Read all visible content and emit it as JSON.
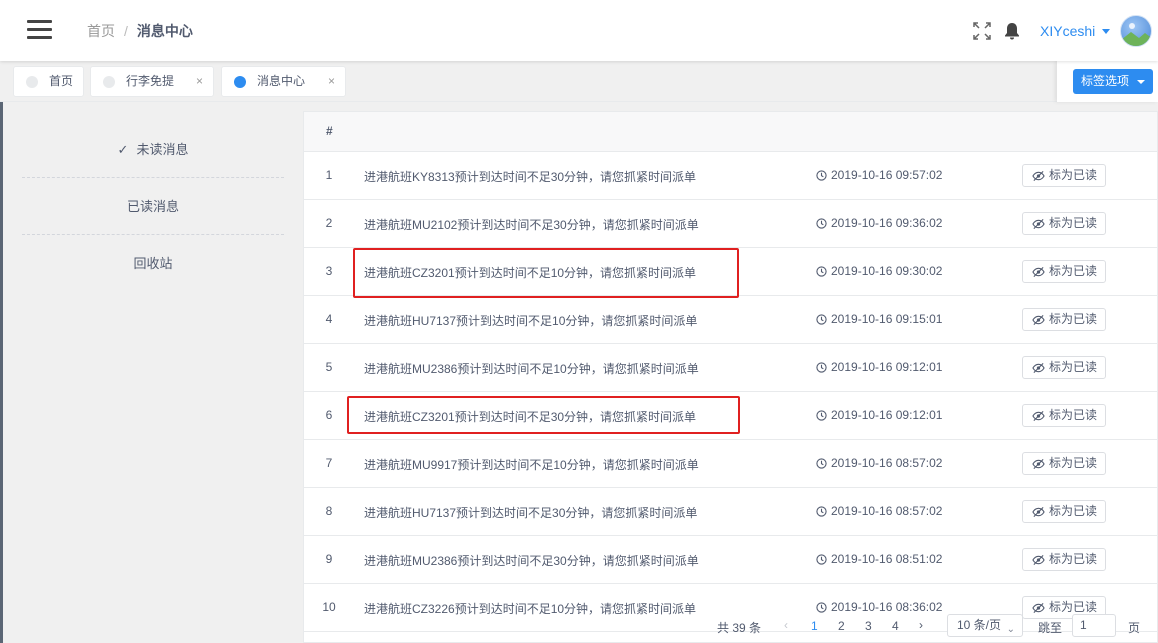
{
  "header": {
    "breadcrumb": [
      "首页",
      "消息中心"
    ],
    "breadcrumb_sep": "/",
    "user": "XIYceshi"
  },
  "tags": {
    "items": [
      {
        "label": "首页",
        "closable": false,
        "active": false
      },
      {
        "label": "行李免提",
        "closable": true,
        "active": false
      },
      {
        "label": "消息中心",
        "closable": true,
        "active": true
      }
    ],
    "close_glyph": "×",
    "options_label": "标签选项"
  },
  "sidebar": {
    "items": [
      {
        "label": "未读消息",
        "selected": true
      },
      {
        "label": "已读消息",
        "selected": false
      },
      {
        "label": "回收站",
        "selected": false
      }
    ]
  },
  "table": {
    "header_index": "#",
    "button_label": "标为已读",
    "rows": [
      {
        "index": "1",
        "message": "进港航班KY8313预计到达时间不足30分钟，请您抓紧时间派单",
        "time": "2019-10-16 09:57:02"
      },
      {
        "index": "2",
        "message": "进港航班MU2102预计到达时间不足30分钟，请您抓紧时间派单",
        "time": "2019-10-16 09:36:02"
      },
      {
        "index": "3",
        "message": "进港航班CZ3201预计到达时间不足10分钟，请您抓紧时间派单",
        "time": "2019-10-16 09:30:02"
      },
      {
        "index": "4",
        "message": "进港航班HU7137预计到达时间不足10分钟，请您抓紧时间派单",
        "time": "2019-10-16 09:15:01"
      },
      {
        "index": "5",
        "message": "进港航班MU2386预计到达时间不足10分钟，请您抓紧时间派单",
        "time": "2019-10-16 09:12:01"
      },
      {
        "index": "6",
        "message": "进港航班CZ3201预计到达时间不足30分钟，请您抓紧时间派单",
        "time": "2019-10-16 09:12:01"
      },
      {
        "index": "7",
        "message": "进港航班MU9917预计到达时间不足10分钟，请您抓紧时间派单",
        "time": "2019-10-16 08:57:02"
      },
      {
        "index": "8",
        "message": "进港航班HU7137预计到达时间不足30分钟，请您抓紧时间派单",
        "time": "2019-10-16 08:57:02"
      },
      {
        "index": "9",
        "message": "进港航班MU2386预计到达时间不足30分钟，请您抓紧时间派单",
        "time": "2019-10-16 08:51:02"
      },
      {
        "index": "10",
        "message": "进港航班CZ3226预计到达时间不足10分钟，请您抓紧时间派单",
        "time": "2019-10-16 08:36:02"
      }
    ]
  },
  "pagination": {
    "total_text": "共 39 条",
    "prev": "‹",
    "pages": [
      "1",
      "2",
      "3",
      "4"
    ],
    "current": "1",
    "next": "›",
    "page_size": "10 条/页",
    "jump_label": "跳至",
    "jump_value": "1",
    "page_unit": "页"
  },
  "colors": {
    "accent": "#2d8cf0",
    "highlight": "#e02020"
  }
}
